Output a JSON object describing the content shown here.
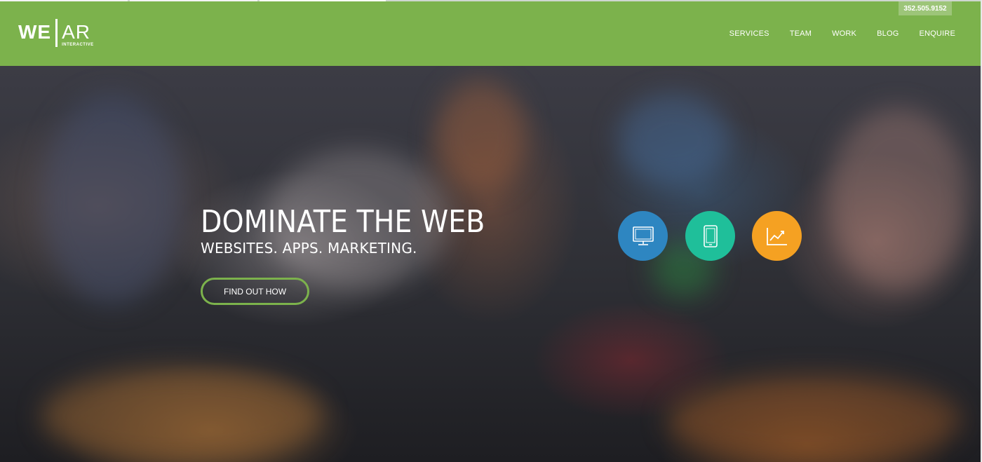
{
  "header": {
    "logo": {
      "we": "WE",
      "ar": "AR",
      "tagline": "INTERACTIVE"
    },
    "phone": "352.505.9152",
    "nav": [
      {
        "label": "SERVICES"
      },
      {
        "label": "TEAM"
      },
      {
        "label": "WORK"
      },
      {
        "label": "BLOG"
      },
      {
        "label": "ENQUIRE"
      }
    ]
  },
  "hero": {
    "title": "DOMINATE THE WEB",
    "subtitle": "WEBSITES. APPS. MARKETING.",
    "cta_label": "FIND OUT HOW"
  },
  "services": [
    {
      "icon": "monitor-icon",
      "color": "#2e86c1"
    },
    {
      "icon": "tablet-icon",
      "color": "#1fbf9a"
    },
    {
      "icon": "chart-trend-icon",
      "color": "#f5a122"
    }
  ],
  "colors": {
    "header_green": "#7cb24c",
    "cta_border": "#7cb24c"
  }
}
